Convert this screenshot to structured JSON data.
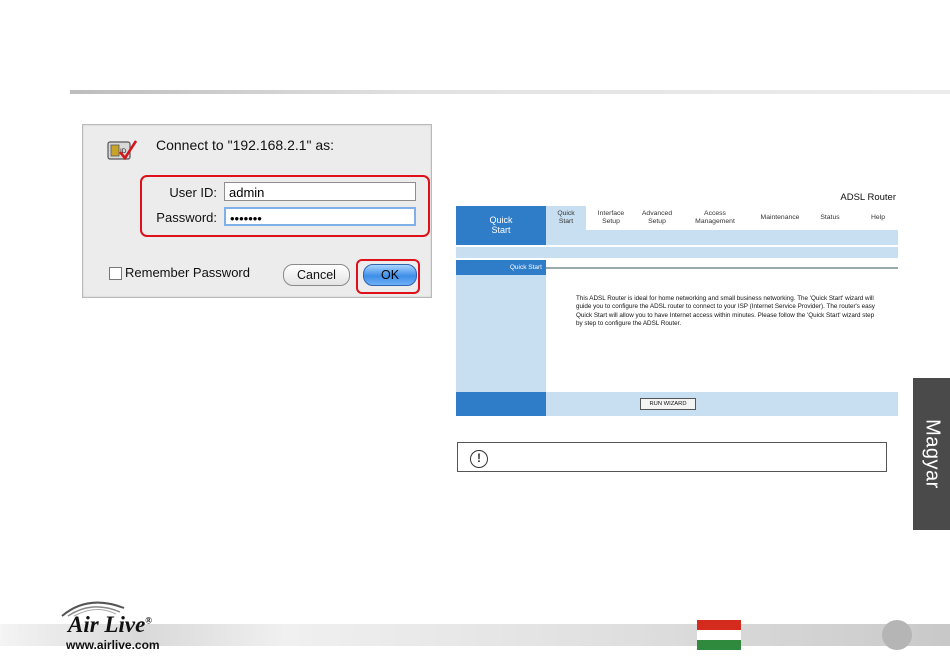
{
  "dialog": {
    "title": "Connect to \"192.168.2.1\" as:",
    "user_id_label": "User ID:",
    "user_id_value": "admin",
    "password_label": "Password:",
    "password_value": "•••••••",
    "remember_label": "Remember Password",
    "cancel_label": "Cancel",
    "ok_label": "OK"
  },
  "router": {
    "brand": "ADSL Router",
    "quick_start_left": [
      "Quick",
      "Start"
    ],
    "nav": [
      {
        "label": "Quick\nStart",
        "active": true
      },
      {
        "label": "Interface\nSetup",
        "active": false
      },
      {
        "label": "Advanced\nSetup",
        "active": false
      },
      {
        "label": "Access\nManagement",
        "active": false
      },
      {
        "label": "Maintenance",
        "active": false
      },
      {
        "label": "Status",
        "active": false
      },
      {
        "label": "Help",
        "active": false
      }
    ],
    "side_heading": "Quick Start",
    "content": "This ADSL Router is ideal for home networking and small business networking. The 'Quick Start' wizard will guide you to configure the ADSL router to connect to your ISP (Internet Service Provider). The router's easy Quick Start will allow you to have Internet access within minutes. Please follow the 'Quick Start' wizard step by step to configure the ADSL Router.",
    "wizard_button": "RUN WIZARD"
  },
  "warning": {
    "icon": "exclamation-circle-icon"
  },
  "side_tab": {
    "label": "Magyar"
  },
  "footer": {
    "logo_text": "Air Live",
    "logo_mark": "®",
    "url": "www.airlive.com",
    "flag_colors": [
      "#d52b1e",
      "#ffffff",
      "#2f8a3e"
    ]
  },
  "colors": {
    "accent_red": "#e0101a",
    "router_blue": "#2f7cc9",
    "router_light": "#c8dff1",
    "tab_gray": "#4a4a4a"
  }
}
